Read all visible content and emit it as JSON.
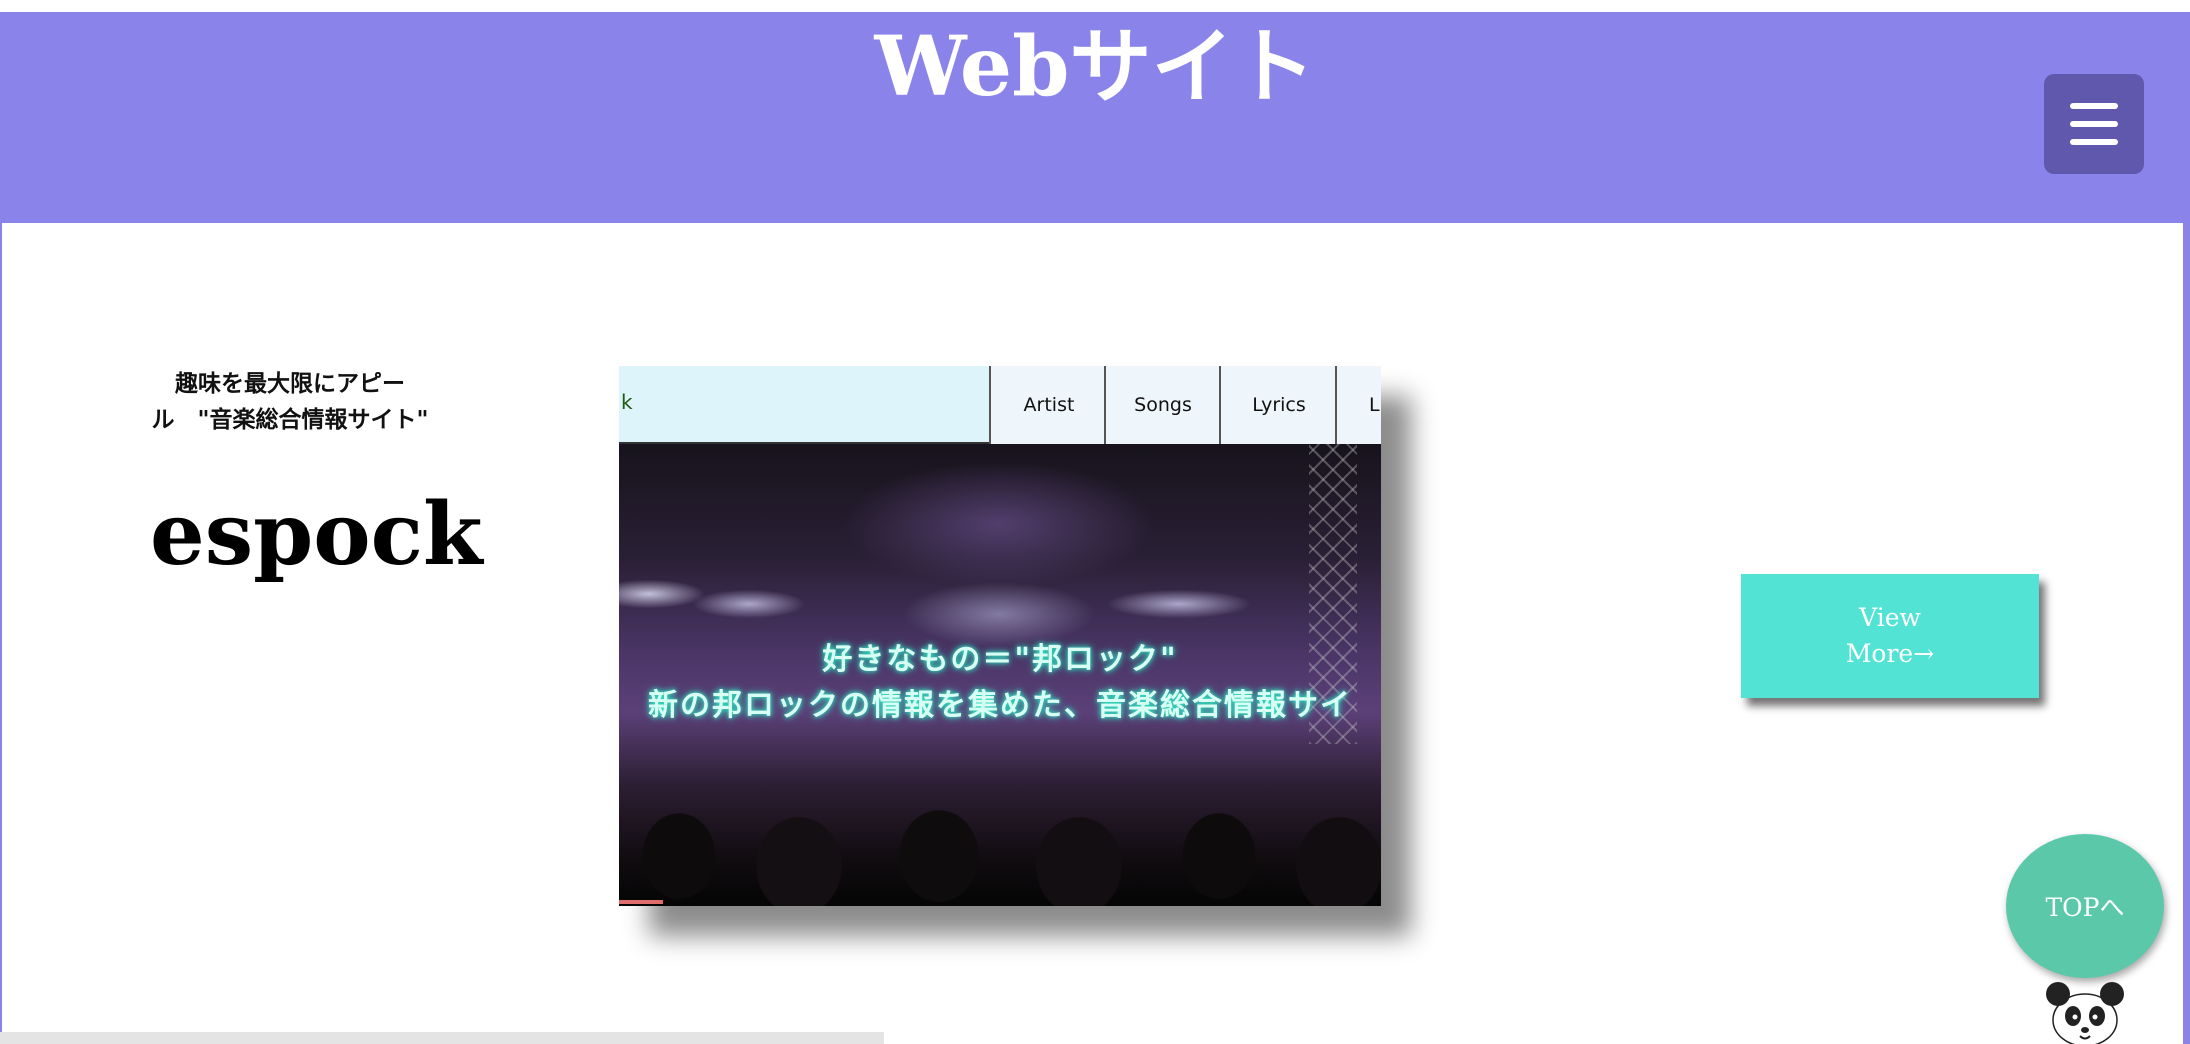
{
  "header": {
    "title": "Webサイト",
    "menu_icon": "hamburger-menu-icon",
    "background_color": "#8a84ea"
  },
  "intro": {
    "tagline_line1": "趣味を最大限にアピー",
    "tagline_line2": "ル　\"音楽総合情報サイト\"",
    "brand_name": "espock"
  },
  "preview": {
    "logo_text": "k",
    "nav_items": [
      "Artist",
      "Songs",
      "Lyrics",
      "Li"
    ],
    "hero_line1": "好きなもの＝\"邦ロック\"",
    "hero_line2": "新の邦ロックの情報を集めた、音楽総合情報サイ"
  },
  "actions": {
    "view_more_label": "View More→",
    "top_label": "TOPへ",
    "accent_color": "#52e3d4",
    "top_color": "#5bc8aa"
  }
}
